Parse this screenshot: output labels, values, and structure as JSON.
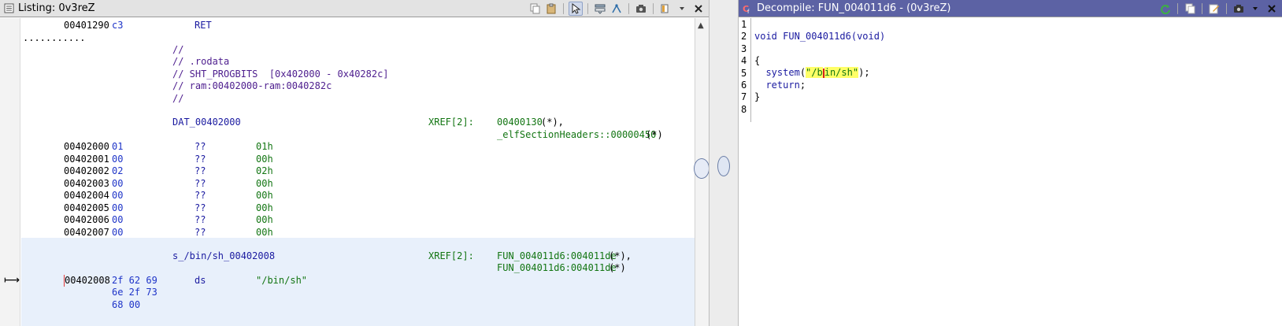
{
  "listing": {
    "title": "Listing:  0v3reZ",
    "lines": {
      "ret_addr": "00401290",
      "ret_byte": "c3",
      "ret_mnem": "RET",
      "dots": "...........",
      "cmt1": "//",
      "cmt2": "// .rodata",
      "cmt3": "// SHT_PROGBITS  [0x402000 - 0x40282c]",
      "cmt4": "// ram:00402000-ram:0040282c",
      "cmt5": "//",
      "dat_label": "DAT_00402000",
      "dat_xref_tag": "XREF[2]:",
      "dat_xref1": "00400130",
      "dat_xref1_suffix": "(*),",
      "dat_xref2": "_elfSectionHeaders::00000450",
      "dat_xref2_suffix": "(*)"
    },
    "data_rows": [
      {
        "addr": "00402000",
        "byte": "01",
        "mnem": "??",
        "val": "01h"
      },
      {
        "addr": "00402001",
        "byte": "00",
        "mnem": "??",
        "val": "00h"
      },
      {
        "addr": "00402002",
        "byte": "02",
        "mnem": "??",
        "val": "02h"
      },
      {
        "addr": "00402003",
        "byte": "00",
        "mnem": "??",
        "val": "00h"
      },
      {
        "addr": "00402004",
        "byte": "00",
        "mnem": "??",
        "val": "00h"
      },
      {
        "addr": "00402005",
        "byte": "00",
        "mnem": "??",
        "val": "00h"
      },
      {
        "addr": "00402006",
        "byte": "00",
        "mnem": "??",
        "val": "00h"
      },
      {
        "addr": "00402007",
        "byte": "00",
        "mnem": "??",
        "val": "00h"
      }
    ],
    "str_block": {
      "label": "s_/bin/sh_00402008",
      "xref_tag": "XREF[2]:",
      "xref1": "FUN_004011d6:004011de",
      "xref1_suffix": "(*),",
      "xref2": "FUN_004011d6:004011de",
      "xref2_suffix": "(*)",
      "addr": "00402008",
      "bytes1": "2f 62 69",
      "bytes2": "6e 2f 73",
      "bytes3": "68 00",
      "mnem": "ds",
      "value": "\"/bin/sh\""
    }
  },
  "decompile": {
    "title": "Decompile: FUN_004011d6 - (0v3reZ)",
    "line_numbers": [
      "1",
      "2",
      "3",
      "4",
      "5",
      "6",
      "7",
      "8"
    ],
    "code": {
      "sig_type": "void",
      "sig_name": "FUN_004011d6",
      "sig_params": "(void)",
      "open_brace": "{",
      "call_name": "system",
      "call_open": "(",
      "str_a": "\"/b",
      "str_b": "in/sh\"",
      "call_close": ");",
      "ret_kw": "return",
      "ret_semi": ";",
      "close_brace": "}"
    }
  },
  "icons": {
    "listing_title": "listing-icon",
    "decompile_title": "decompile-icon"
  },
  "colors": {
    "decompile_titlebar": "#5c62a4",
    "selection_band": "#e8f0fb",
    "string_highlight": "#ffff66",
    "xref_green": "#127512",
    "byte_blue": "#1e34c8"
  }
}
